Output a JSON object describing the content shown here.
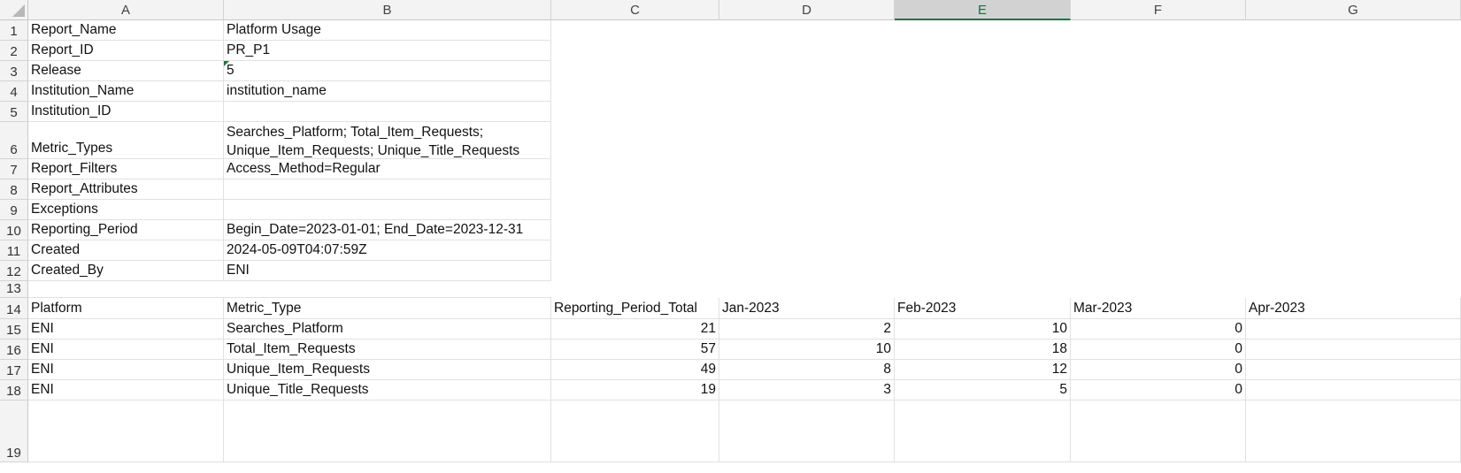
{
  "columns": [
    "A",
    "B",
    "C",
    "D",
    "E",
    "F",
    "G"
  ],
  "selected_column": "E",
  "rows": [
    {
      "num": "1",
      "cells": [
        "Report_Name",
        "Platform Usage",
        "",
        "",
        "",
        "",
        ""
      ]
    },
    {
      "num": "2",
      "cells": [
        "Report_ID",
        "PR_P1",
        "",
        "",
        "",
        "",
        ""
      ]
    },
    {
      "num": "3",
      "cells": [
        "Release",
        "5",
        "",
        "",
        "",
        "",
        ""
      ]
    },
    {
      "num": "4",
      "cells": [
        "Institution_Name",
        "institution_name",
        "",
        "",
        "",
        "",
        ""
      ]
    },
    {
      "num": "5",
      "cells": [
        "Institution_ID",
        "",
        "",
        "",
        "",
        "",
        ""
      ]
    },
    {
      "num": "6",
      "cells": [
        "Metric_Types",
        "Searches_Platform; Total_Item_Requests;\nUnique_Item_Requests; Unique_Title_Requests",
        "",
        "",
        "",
        "",
        ""
      ]
    },
    {
      "num": "7",
      "cells": [
        "Report_Filters",
        "Access_Method=Regular",
        "",
        "",
        "",
        "",
        ""
      ]
    },
    {
      "num": "8",
      "cells": [
        "Report_Attributes",
        "",
        "",
        "",
        "",
        "",
        ""
      ]
    },
    {
      "num": "9",
      "cells": [
        "Exceptions",
        "",
        "",
        "",
        "",
        "",
        ""
      ]
    },
    {
      "num": "10",
      "cells": [
        "Reporting_Period",
        "Begin_Date=2023-01-01; End_Date=2023-12-31",
        "",
        "",
        "",
        "",
        ""
      ]
    },
    {
      "num": "11",
      "cells": [
        "Created",
        "2024-05-09T04:07:59Z",
        "",
        "",
        "",
        "",
        ""
      ]
    },
    {
      "num": "12",
      "cells": [
        "Created_By",
        "ENI",
        "",
        "",
        "",
        "",
        ""
      ]
    },
    {
      "num": "13",
      "cells": [
        "",
        "",
        "",
        "",
        "",
        "",
        ""
      ]
    },
    {
      "num": "14",
      "cells": [
        "Platform",
        "Metric_Type",
        "Reporting_Period_Total",
        "Jan-2023",
        "Feb-2023",
        "Mar-2023",
        "Apr-2023"
      ]
    },
    {
      "num": "15",
      "cells": [
        "ENI",
        "Searches_Platform",
        "21",
        "2",
        "10",
        "0",
        ""
      ]
    },
    {
      "num": "16",
      "cells": [
        "ENI",
        "Total_Item_Requests",
        "57",
        "10",
        "18",
        "0",
        ""
      ]
    },
    {
      "num": "17",
      "cells": [
        "ENI",
        "Unique_Item_Requests",
        "49",
        "8",
        "12",
        "0",
        ""
      ]
    },
    {
      "num": "18",
      "cells": [
        "ENI",
        "Unique_Title_Requests",
        "19",
        "3",
        "5",
        "0",
        ""
      ]
    },
    {
      "num": "19",
      "cells": [
        "",
        "",
        "",
        "",
        "",
        "",
        ""
      ]
    }
  ]
}
